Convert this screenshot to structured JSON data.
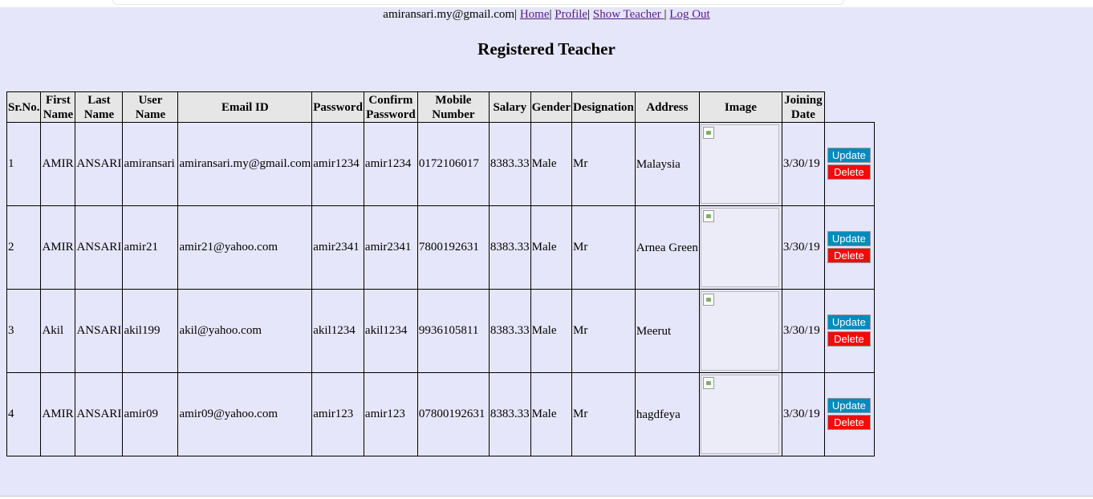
{
  "header": {
    "user_email": "amiransari.my@gmail.com",
    "links": [
      "Home",
      "Profile",
      "Show Teacher ",
      "Log Out"
    ]
  },
  "page_title": "Registered Teacher",
  "table": {
    "columns": [
      "Sr.No.",
      "First Name",
      "Last Name",
      "User Name",
      "Email ID",
      "Password",
      "Confirm Password",
      "Mobile Number",
      "Salary",
      "Gender",
      "Designation",
      "Address",
      "Image",
      "Joining Date"
    ],
    "rows": [
      {
        "sr": "1",
        "first": "AMIR",
        "last": "ANSARI",
        "user": "amiransari",
        "email": "amiransari.my@gmail.com",
        "password": "amir1234",
        "confirm": "amir1234",
        "mobile": "0172106017",
        "salary": "8383.33",
        "gender": "Male",
        "designation": "Mr",
        "address": "Malaysia",
        "joining": "3/30/19"
      },
      {
        "sr": "2",
        "first": "AMIR",
        "last": "ANSARI",
        "user": "amir21",
        "email": "amir21@yahoo.com",
        "password": "amir2341",
        "confirm": "amir2341",
        "mobile": "7800192631",
        "salary": "8383.33",
        "gender": "Male",
        "designation": "Mr",
        "address": "Arnea Green",
        "joining": "3/30/19"
      },
      {
        "sr": "3",
        "first": "Akil",
        "last": "ANSARI",
        "user": "akil199",
        "email": "akil@yahoo.com",
        "password": "akil1234",
        "confirm": "akil1234",
        "mobile": "9936105811",
        "salary": "8383.33",
        "gender": "Male",
        "designation": "Mr",
        "address": "Meerut",
        "joining": "3/30/19"
      },
      {
        "sr": "4",
        "first": "AMIR",
        "last": "ANSARI",
        "user": "amir09",
        "email": "amir09@yahoo.com",
        "password": "amir123",
        "confirm": "amir123",
        "mobile": "07800192631",
        "salary": "8383.33",
        "gender": "Male",
        "designation": "Mr",
        "address": "hagdfeya",
        "joining": "3/30/19"
      }
    ],
    "update_label": "Update",
    "delete_label": "Delete"
  },
  "colors": {
    "page_bg": "#e6e6fa",
    "header_bg": "#e6e6e6",
    "update_btn": "#008cba",
    "delete_btn": "#f00c0c",
    "link": "#551a8b"
  }
}
